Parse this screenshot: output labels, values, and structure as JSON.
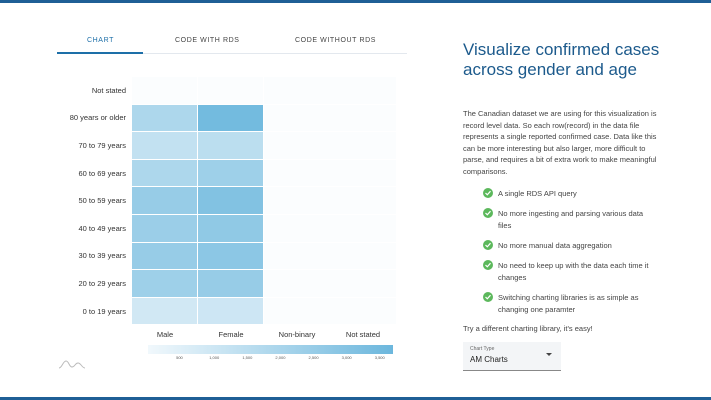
{
  "tabs": [
    {
      "label": "CHART",
      "active": true
    },
    {
      "label": "CODE WITH RDS",
      "active": false
    },
    {
      "label": "CODE WITHOUT RDS",
      "active": false
    }
  ],
  "chart_data": {
    "type": "heatmap",
    "title": "",
    "xlabel": "",
    "ylabel": "",
    "categories_x": [
      "Male",
      "Female",
      "Non-binary",
      "Not stated"
    ],
    "categories_y": [
      "Not stated",
      "80 years or older",
      "70 to 79 years",
      "60 to 69 years",
      "50 to 59 years",
      "40 to 49 years",
      "30 to 39 years",
      "20 to 29 years",
      "0 to 19 years"
    ],
    "values": [
      [
        0,
        0,
        0,
        0
      ],
      [
        1900,
        3500,
        0,
        0
      ],
      [
        1300,
        1500,
        0,
        0
      ],
      [
        1900,
        2300,
        0,
        0
      ],
      [
        2500,
        3100,
        0,
        0
      ],
      [
        2400,
        2700,
        0,
        0
      ],
      [
        2500,
        2800,
        0,
        0
      ],
      [
        2300,
        2500,
        0,
        0
      ],
      [
        900,
        1000,
        0,
        0
      ]
    ],
    "color_range": [
      "#f1f8fc",
      "#6cb7dd"
    ],
    "colorscale_min": 0,
    "colorscale_max": 3700,
    "colorscale_ticks": [
      "500",
      "1,000",
      "1,500",
      "2,000",
      "2,500",
      "3,000",
      "3,500"
    ],
    "colorscale_tick_values": [
      500,
      1000,
      1500,
      2000,
      2500,
      3000,
      3500
    ]
  },
  "info": {
    "title": "Visualize confirmed cases across gender and age",
    "description": "The Canadian dataset we are using for this visualization is record level data. So each row(record) in the data file represents a single reported confirmed case. Data like this can be more interesting but also larger, more difficult to parse, and requires a bit of extra work to make meaningful comparisons.",
    "features": [
      "A single RDS API query",
      "No more ingesting and parsing various data files",
      "No more manual data aggregation",
      "No need to keep up with the data each time it changes",
      "Switching charting libraries is as simple as changing one paramter"
    ],
    "try_text": "Try a different charting library, it's easy!",
    "select": {
      "label": "Chart Type",
      "value": "AM Charts"
    }
  },
  "colors": {
    "accent": "#1d6fa8",
    "title": "#1c5a8c",
    "check": "#5cb85c"
  }
}
